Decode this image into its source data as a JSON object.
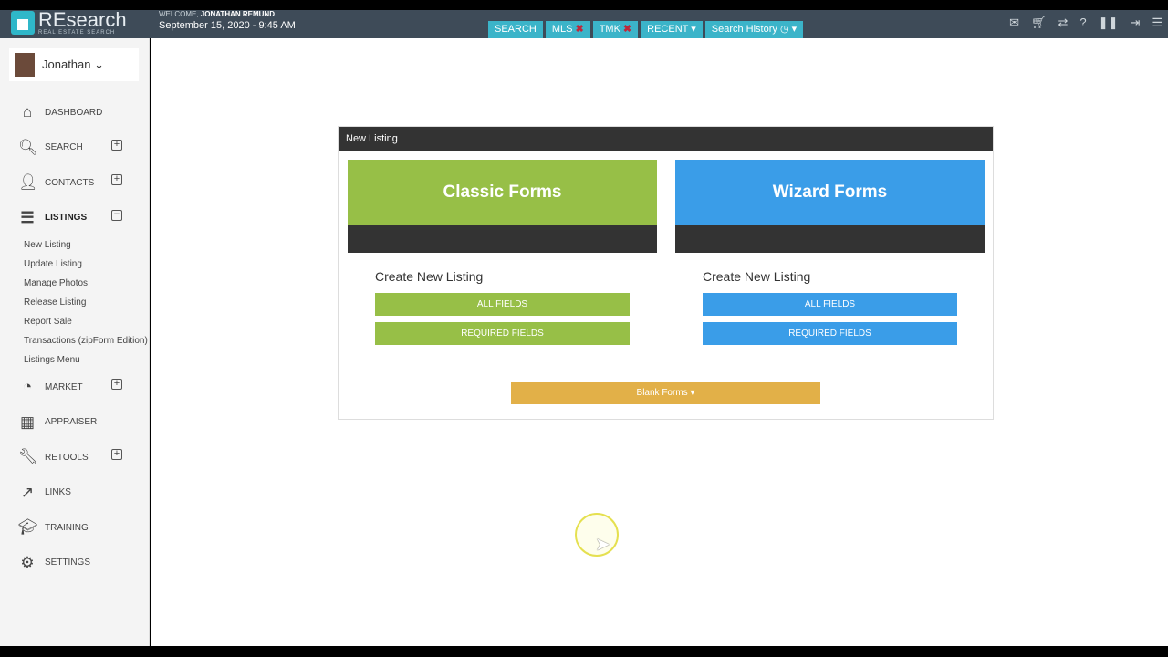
{
  "header": {
    "logo_title": "REsearch",
    "logo_subtitle": "REAL ESTATE SEARCH",
    "welcome_label": "WELCOME,",
    "user_name": "JONATHAN REMUND",
    "datetime": "September 15, 2020 - 9:45 AM",
    "nav": [
      {
        "label": "SEARCH"
      },
      {
        "label": "MLS",
        "close": "✖"
      },
      {
        "label": "TMK",
        "close": "✖"
      },
      {
        "label": "RECENT ▾"
      },
      {
        "label": "Search History ◷ ▾"
      }
    ]
  },
  "sidebar": {
    "user": "Jonathan ⌄",
    "items": [
      {
        "label": "DASHBOARD",
        "icon": "⌂"
      },
      {
        "label": "SEARCH",
        "icon": "🔍︎"
      },
      {
        "label": "CONTACTS",
        "icon": "👤︎"
      },
      {
        "label": "LISTINGS",
        "icon": "☰"
      },
      {
        "label": "MARKET",
        "icon": "◔"
      },
      {
        "label": "APPRAISER",
        "icon": "▦"
      },
      {
        "label": "RETOOLS",
        "icon": "🔧︎"
      },
      {
        "label": "LINKS",
        "icon": "↗"
      },
      {
        "label": "TRAINING",
        "icon": "🎓︎"
      },
      {
        "label": "SETTINGS",
        "icon": "⚙"
      }
    ],
    "listings_sub": [
      "New Listing",
      "Update Listing",
      "Manage Photos",
      "Release Listing",
      "Report Sale",
      "Transactions (zipForm Edition)",
      "Listings Menu"
    ]
  },
  "panel": {
    "title": "New Listing",
    "classic": {
      "title": "Classic Forms",
      "subtitle": "Create New Listing",
      "all": "ALL FIELDS",
      "required": "REQUIRED FIELDS",
      "color": "#97bf47"
    },
    "wizard": {
      "title": "Wizard Forms",
      "subtitle": "Create New Listing",
      "all": "ALL FIELDS",
      "required": "REQUIRED FIELDS",
      "color": "#3a9de8"
    },
    "blank": "Blank Forms ▾"
  }
}
